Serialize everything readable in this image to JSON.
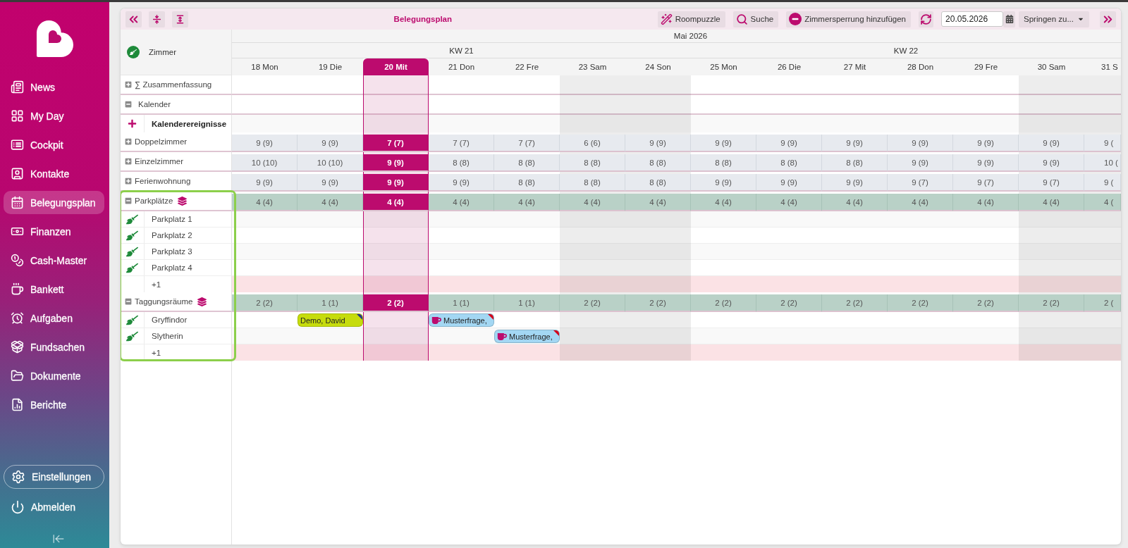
{
  "sidebar": {
    "items": [
      {
        "label": "News",
        "selected": false
      },
      {
        "label": "My Day",
        "selected": false
      },
      {
        "label": "Cockpit",
        "selected": false
      },
      {
        "label": "Kontakte",
        "selected": false
      },
      {
        "label": "Belegungsplan",
        "selected": true
      },
      {
        "label": "Finanzen",
        "selected": false
      },
      {
        "label": "Cash-Master",
        "selected": false
      },
      {
        "label": "Bankett",
        "selected": false
      },
      {
        "label": "Aufgaben",
        "selected": false
      },
      {
        "label": "Fundsachen",
        "selected": false
      },
      {
        "label": "Dokumente",
        "selected": false
      },
      {
        "label": "Berichte",
        "selected": false
      }
    ],
    "footer": [
      {
        "kind": "outlined",
        "label": "Einstellungen"
      },
      {
        "kind": "plain",
        "label": "Abmelden"
      }
    ]
  },
  "toolbar": {
    "title": "Belegungsplan",
    "buttons": [
      {
        "label": "Roompuzzle"
      },
      {
        "label": "Suche"
      },
      {
        "label": "Zimmersperrung hinzufügen"
      }
    ],
    "date_field": {
      "value": "20.05.2026"
    },
    "jump_menu": {
      "label": "Springen zu..."
    }
  },
  "header": {
    "corner_label": "Zimmer",
    "month": "Mai 2026",
    "weeks": [
      "KW 21",
      "KW 22"
    ],
    "days": [
      {
        "label": "18 Mon",
        "selected": false,
        "weekend": false
      },
      {
        "label": "19 Die",
        "selected": false,
        "weekend": false
      },
      {
        "label": "20 Mit",
        "selected": true,
        "weekend": false
      },
      {
        "label": "21 Don",
        "selected": false,
        "weekend": false
      },
      {
        "label": "22 Fre",
        "selected": false,
        "weekend": false
      },
      {
        "label": "23 Sam",
        "selected": false,
        "weekend": true
      },
      {
        "label": "24 Son",
        "selected": false,
        "weekend": true
      },
      {
        "label": "25 Mon",
        "selected": false,
        "weekend": false
      },
      {
        "label": "26 Die",
        "selected": false,
        "weekend": false
      },
      {
        "label": "27 Mit",
        "selected": false,
        "weekend": false
      },
      {
        "label": "28 Don",
        "selected": false,
        "weekend": false
      },
      {
        "label": "29 Fre",
        "selected": false,
        "weekend": false
      },
      {
        "label": "30 Sam",
        "selected": false,
        "weekend": true
      },
      {
        "label": "31 S",
        "selected": false,
        "weekend": true
      }
    ]
  },
  "rows": [
    {
      "kind": "summary",
      "label": "∑ Zusammenfassung",
      "expanded": false
    },
    {
      "kind": "calendar_group",
      "label": "Kalender",
      "expanded": true,
      "children": [
        {
          "kind": "event_type",
          "label": "Kalenderereignisse"
        }
      ]
    },
    {
      "kind": "room_category",
      "label": "Doppelzimmer",
      "expanded": false,
      "counts": [
        "9 (9)",
        "9 (9)",
        "7 (7)",
        "7 (7)",
        "7 (7)",
        "6 (6)",
        "9 (9)",
        "9 (9)",
        "9 (9)",
        "9 (9)",
        "9 (9)",
        "9 (9)",
        "9 (9)",
        "9 ("
      ]
    },
    {
      "kind": "room_category",
      "label": "Einzelzimmer",
      "expanded": false,
      "counts": [
        "10 (10)",
        "10 (10)",
        "9 (9)",
        "8 (8)",
        "8 (8)",
        "8 (8)",
        "8 (8)",
        "8 (8)",
        "8 (8)",
        "8 (8)",
        "9 (9)",
        "9 (9)",
        "9 (9)",
        "10 ("
      ]
    },
    {
      "kind": "room_category",
      "label": "Ferienwohnung",
      "expanded": false,
      "counts": [
        "9 (9)",
        "9 (9)",
        "9 (9)",
        "9 (9)",
        "8 (8)",
        "8 (8)",
        "8 (8)",
        "9 (9)",
        "9 (9)",
        "9 (9)",
        "9 (7)",
        "9 (7)",
        "9 (7)",
        "9 ("
      ]
    },
    {
      "kind": "resource_category",
      "label": "Parkplätze",
      "expanded": true,
      "highlighted": true,
      "counts": [
        "4 (4)",
        "4 (4)",
        "4 (4)",
        "4 (4)",
        "4 (4)",
        "4 (4)",
        "4 (4)",
        "4 (4)",
        "4 (4)",
        "4 (4)",
        "4 (4)",
        "4 (4)",
        "4 (4)",
        "4 ("
      ],
      "children": [
        {
          "kind": "room",
          "label": "Parkplatz 1"
        },
        {
          "kind": "room",
          "label": "Parkplatz 2"
        },
        {
          "kind": "room",
          "label": "Parkplatz 3"
        },
        {
          "kind": "room",
          "label": "Parkplatz 4"
        },
        {
          "kind": "more",
          "label": "+1"
        }
      ]
    },
    {
      "kind": "resource_category",
      "label": "Taggungsräume",
      "expanded": true,
      "highlighted": true,
      "counts": [
        "2 (2)",
        "1 (1)",
        "2 (2)",
        "1 (1)",
        "1 (1)",
        "2 (2)",
        "2 (2)",
        "2 (2)",
        "2 (2)",
        "2 (2)",
        "2 (2)",
        "2 (2)",
        "2 (2)",
        "2 ("
      ],
      "children": [
        {
          "kind": "room",
          "label": "Gryffindor",
          "cells": [
            null,
            {
              "kind": "guest",
              "label": "Demo, David",
              "color": "#c6dc0c",
              "flag": {
                "color": "#26368c"
              }
            },
            null,
            {
              "kind": "event",
              "label": "Musterfrage,",
              "color": "#a3d7f3",
              "flag": {
                "color": "#d4001a"
              }
            }
          ]
        },
        {
          "kind": "room",
          "label": "Slytherin",
          "cells": [
            null,
            null,
            null,
            null,
            {
              "kind": "event",
              "label": "Musterfrage,",
              "color": "#a3d7f3",
              "flag": {
                "color": "#d4001a"
              }
            }
          ]
        },
        {
          "kind": "more",
          "label": "+1"
        }
      ]
    }
  ]
}
